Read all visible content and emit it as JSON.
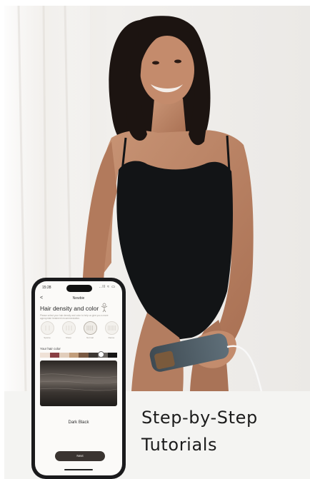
{
  "caption": {
    "line1": "Step-by-Step",
    "line2": "Tutorials"
  },
  "phone": {
    "status": {
      "time": "15:28",
      "icons": "..ll ≈ ▭"
    },
    "nav": {
      "back": "<",
      "title": "Newbie"
    },
    "title": "Hair density and color",
    "description": "Please select your hair density and color to help us give you a more appropriate treatment recommendation.",
    "density_options": [
      {
        "label": "Sparse"
      },
      {
        "label": "Sharp"
      },
      {
        "label": "Normal",
        "selected": true
      },
      {
        "label": "Dense"
      }
    ],
    "hair_color_label": "Your hair color",
    "swatches": [
      "#efe1d6",
      "#8a3f44",
      "#e1cdbb",
      "#c29e7c",
      "#7a5a44",
      "#3c3733",
      "#6b6763",
      "#161616"
    ],
    "selected_color": "Dark Black",
    "next_label": "Next"
  },
  "colors": {
    "background": "#f4f3f1",
    "button": "#3a3431",
    "caption_text": "#1c1c1c"
  }
}
